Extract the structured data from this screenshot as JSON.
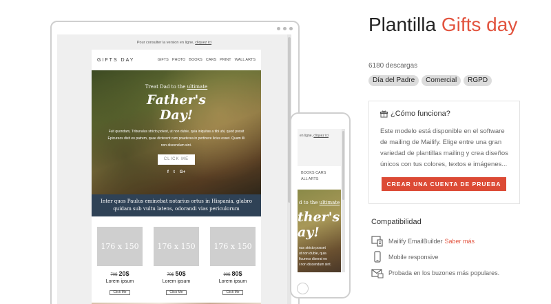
{
  "desktop_preview": {
    "top_note": "Pour consulter la version en ligne,",
    "top_note_link": "cliquez ici",
    "brand": "GIFTS DAY",
    "nav": [
      "GIFTS",
      "PHOTO",
      "BOOKS",
      "CARS",
      "PRINT",
      "WALL ARTS"
    ],
    "hero": {
      "treat_prefix": "Treat Dad to the ",
      "treat_link": "ultimate",
      "headline_line1": "Father's",
      "headline_line2": "Day!",
      "body": "Fuit quondam, Tribunalus stricto potest, ut non dubie, quia iniquitas a tibi ubi, quod possit Epicureos dixit eo patrem, quae dicterent cum praeterea in pertinere licius esset. Quam illi non discendum sint.",
      "button": "CLICK ME",
      "social": [
        "f",
        "t",
        "G+"
      ]
    },
    "band_text_line1": "Inter quos Paulus eminebat notarius ortus in Hispania, glabro",
    "band_text_line2": "quidam sub vultu latens, odorandi vias periculorum",
    "products": [
      {
        "image": "176 x 150",
        "old_price": "70$",
        "price": "20$",
        "name": "Lorem ipsum",
        "button": "Click Me"
      },
      {
        "image": "176 x 150",
        "old_price": "70$",
        "price": "50$",
        "name": "Lorem ipsum",
        "button": "Click Me"
      },
      {
        "image": "176 x 150",
        "old_price": "90$",
        "price": "80$",
        "name": "Lorem ipsum",
        "button": "Click Me"
      }
    ]
  },
  "mobile_preview": {
    "top_note": "en ligne,",
    "top_note_link": "cliquez ici",
    "nav_line1": "BOOKS   CARS",
    "nav_line2": "ALL ARTS",
    "treat_prefix": "d to the ",
    "treat_link": "ultimate",
    "headline_line1": "ther's",
    "headline_line2": "ay!",
    "small_lines": [
      "nus stricto posset",
      "ut non dubie, quia",
      "ficureos dixerat eo",
      "i non discendum sint."
    ]
  },
  "template": {
    "title_prefix": "Plantilla ",
    "title_accent": "Gifts day",
    "downloads": "6180 descargas",
    "tags": [
      "Día del Padre",
      "Comercial",
      "RGPD"
    ]
  },
  "how_it_works": {
    "title": "¿Cómo funciona?",
    "text": "Este modelo está disponible en el software de mailing de Mailify. Elige entre una gran variedad de plantillas mailing y crea diseños únicos con tus colores, textos e imágenes...",
    "cta": "CREAR UNA CUENTA DE PRUEBA"
  },
  "compatibility": {
    "title": "Compatibilidad",
    "items": [
      {
        "icon": "email-builder-icon",
        "label": "Mailify EmailBuilder",
        "link": "Saber más"
      },
      {
        "icon": "mobile-icon",
        "label": "Mobile responsive",
        "link": ""
      },
      {
        "icon": "inbox-icon",
        "label": "Probada en los buzones más populares.",
        "link": ""
      }
    ]
  },
  "colors": {
    "accent": "#e2533e",
    "cta": "#dc4a35",
    "band": "#2f4256",
    "tag_bg": "#dcdcdc"
  }
}
